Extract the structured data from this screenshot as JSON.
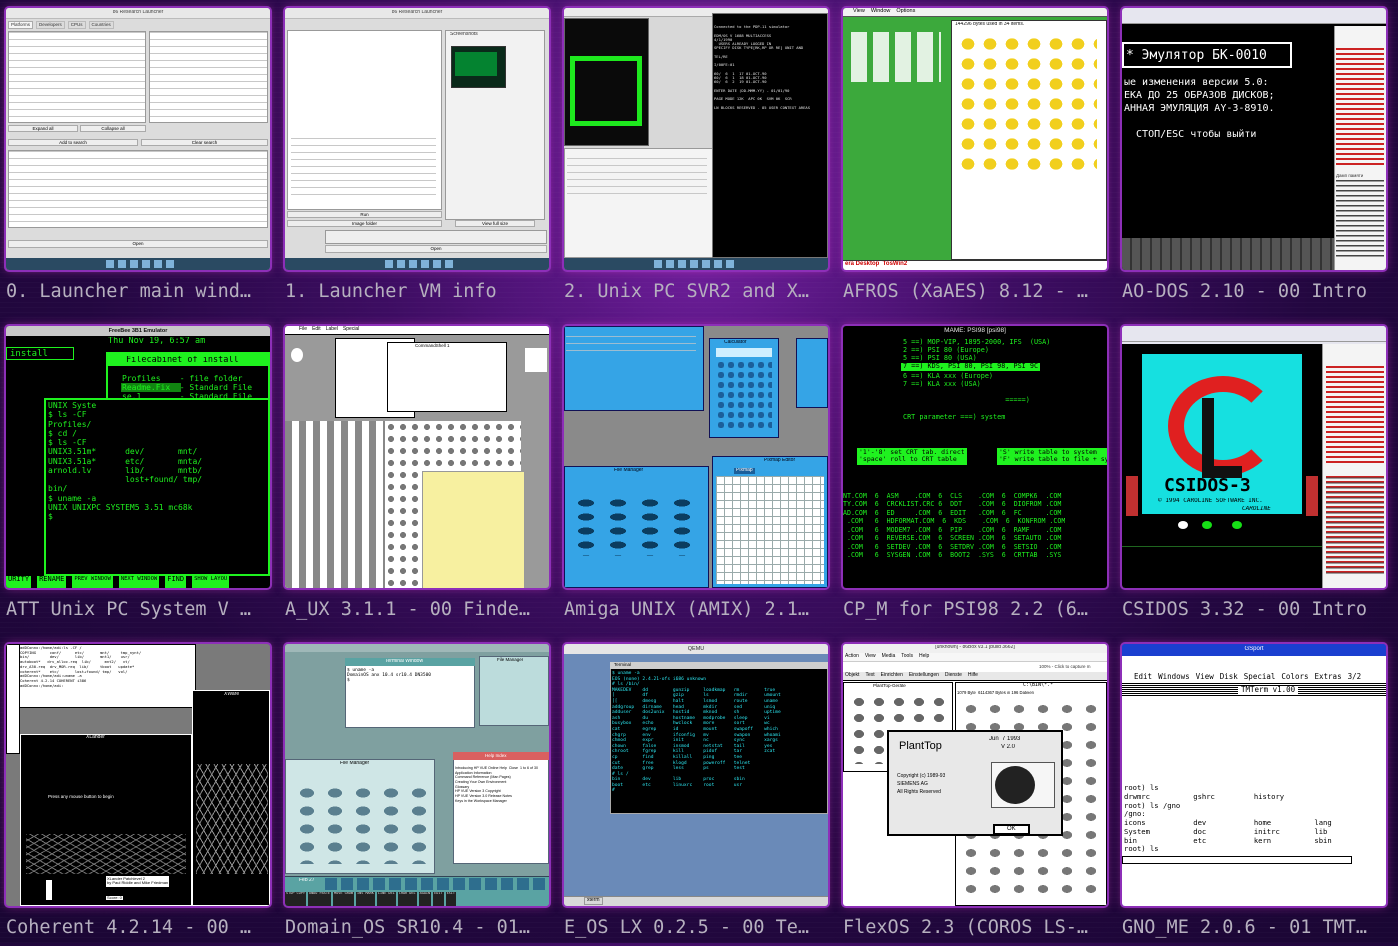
{
  "cards": [
    {
      "caption": "0. Launcher main wind…",
      "title": "86 Research Launcher",
      "tabs": [
        "Platforms",
        "Developers",
        "CPUs",
        "Countries"
      ],
      "buttons": [
        "Expand all",
        "Collapse all",
        "Add to search",
        "Clear search",
        "Open"
      ]
    },
    {
      "caption": "1. Launcher VM info",
      "title": "86 Research Launcher",
      "panel": "Screenshots",
      "buttons": [
        "Run",
        "Image folder",
        "View full size",
        "Open"
      ]
    },
    {
      "caption": "2. Unix PC SVR2 and X…",
      "title": "Unix Terminal",
      "lines": [
        "Connected to the PDP-11 simulator",
        "",
        "EDM/OS V 1688 MULTIACCESS",
        "4/1/1990",
        "  USERS ALREADY LOGGED IN",
        "SPECIFY DISK TYPE[RK,RP OR RE] UNIT AND",
        "",
        "TEL/RE",
        "",
        "I/00FE:01",
        "",
        "60/  6  1  17 01-OCT-90",
        "60/  6  1  18 01-OCT-90",
        "60/  6  2  19 01-OCT-90",
        "",
        "ENTER DATE (DD-MMM-YY) - 01/01/90",
        "",
        "PAGE MODE 12K  APC 0K  SVM 0K  SCR",
        "",
        "LN BLOCKS RESERVED - 85 USER CONTEXT AREAS"
      ]
    },
    {
      "caption": "AFROS (XaAES) 8.12 - …",
      "menu": [
        "View",
        "Window",
        "Options"
      ],
      "info": "144296 bytes used in 34 items.",
      "taskbar": "era Desktop  TosWin2"
    },
    {
      "caption": "AO-DOS 2.10 - 00 Intro",
      "banner": "* Эмулятор БК-0010",
      "lines": [
        "ые изменения версии 5.0:",
        "ЕКА ДО 25 ОБРАЗОВ ДИСКОВ;",
        "АННАЯ ЭМУЛЯЦИЯ AY-3-8910.",
        "",
        "  СТОП/ESC чтобы выйти"
      ],
      "side_label": "Дамп памяти"
    },
    {
      "caption": "ATT Unix PC System V …",
      "title": "FreeBee 3B1 Emulator",
      "date": "Thu Nov 19, 6:57 am",
      "window": "Filecabinet of install",
      "rows": [
        "Profiles    - file folder",
        "Readme.Fix  - Standard File",
        "se.1        - Standard File"
      ],
      "shell": [
        "UNIX Syste",
        "$ ls -CF",
        "Profiles/",
        "$ cd /",
        "$ ls -CF",
        "UNIX3.51m*      dev/       mnt/",
        "UNIX3.51a*      etc/       mnta/",
        "arnold.lv       lib/       mntb/",
        "                lost+found/ tmp/",
        "bin/",
        "$ uname -a",
        "UNIX UNIXPC SYSTEM5 3.51 mc68k",
        "$"
      ],
      "fkeys": [
        "URITY",
        "RENAME",
        "PREV WINDOW",
        "NEXT WINDOW",
        "FIND",
        "SHOW LAYOU"
      ]
    },
    {
      "caption": "A_UX 3.1.1 - 00 Finde…",
      "menu": [
        "File",
        "Edit",
        "Label",
        "Special"
      ],
      "window": "CommandShell 1"
    },
    {
      "caption": "Amiga UNIX (AMIX) 2.1…",
      "calc": "Calculator",
      "files": "File Manager",
      "pixmap": "Pixmap Editor",
      "button": "Pixmap"
    },
    {
      "caption": "CP_M for PSI98 2.2 (6…",
      "title": "MAME: PSI98 [psi98]",
      "lines": [
        "5 ==) MOP-VIP, 1895-2000, IFS  (USA)",
        "2 ==) PSI 80 (Europe)",
        "5 ==) PSI 80 (USA)"
      ],
      "hl": "7 ==) KDS, PSI 80, PSI 98, PSI 9C",
      "lines2": [
        "6 ==) KLA xxx (Europe)",
        "7 ==) KLA xxx (USA)",
        "",
        "                         =====)",
        "",
        "CRT parameter ===) system"
      ],
      "box1": "'1'-'8' set CRT tab. direct\n'space' roll to CRT table",
      "box2": "'S' write table to system\n'F' write table to file + syst",
      "dir": [
        "NT.COM  6  ASM    .COM  6  CLS    .COM  6  COMPK6  .COM",
        "TY.COM  6  CRCKLIST.CRC 6  DDT    .COM  6  DIOFROM .COM",
        "AD.COM  6  ED     .COM  6  EDIT   .COM  6  FC      .COM",
        " .COM   6  HDFORMAT.COM  6  KDS    .COM  6  KONFROM .COM",
        " .COM   6  MODEM7 .COM  6  PIP    .COM  6  RAMF    .COM",
        " .COM   6  REVERSE.COM  6  SCREEN .COM  6  SETAUTO .COM",
        " .COM   6  SETDEV .COM  6  SETDRV .COM  6  SETSIO  .COM",
        " .COM   6  SYSGEN .COM  6  BOOT2  .SYS  6  CRTTAB  .SYS"
      ]
    },
    {
      "caption": "CSIDOS 3.32 - 00 Intro",
      "logo": "CSIDOS-3",
      "copy": "© 1994 CAROLINE SOFTWARE INC.",
      "sig": "CAROLINE"
    },
    {
      "caption": "Coherent 4.2.14 - 00 …",
      "terminal": [
        "adDConnx:/home/adi:ls -CF /",
        "COPYING      conf/      etc/       mnt/     tmp_nynt/",
        "bin/         dev/       lib/       mnt1/    usr/",
        "autoboot*   drv_alloc.req  lib/      mnt2/   vt/",
        "drv_A30.req  drv_MOR.req  lib/     tboot   update*",
        "coherent*    etc/       lost+found/ tmp/   vol/",
        "adDConnx:/home/adi:uname -a",
        "Coherent 4.2.14 COHERENT i386",
        "adDConnx:/home/adi:"
      ],
      "xlander": "XLander",
      "prompt": "Press any mouse button to begin",
      "credit": "XLander Patchlevel 2\nby Paul Riddle and Mike Friedman",
      "score": "Score: 0",
      "xware": "XWare"
    },
    {
      "caption": "Domain_OS SR10.4 - 01…",
      "term": "Terminal Window",
      "term_lines": [
        "$ uname -a",
        "DomainOS anx 10.4 sr10.4 DN3500",
        "$"
      ],
      "fm": "File Manager",
      "help": "Help Index",
      "help_lines": [
        "Introducing HP VUE Online Help  Close  1 to 6 of 30",
        "Application Information",
        "Command Reference (Man Pages)",
        "Creating Your Own Environment",
        "Glossary",
        "HP VUE Version 3 Copyright",
        "HP VUE Version 3.0 Release Notes",
        "Keys in the Workspace Manager"
      ],
      "date": "Feb 27",
      "keys": [
        "STOP COPY",
        "UNDO PASTE",
        "MOVE GROW",
        "INS MARK",
        "LINE DEL",
        "CHAR DEL",
        "AGAIN",
        "EDIT",
        "EXIT"
      ]
    },
    {
      "caption": "E_OS LX 0.2.5 - 00 Te…",
      "title": "QEMU",
      "terminal": "Terminal",
      "lines": [
        "$ uname -a",
        "EOS (none) 2.4.21-ofs i686 unknown",
        "# ls /bin/",
        "MAKEDEV    dd         gunzip     loadkmap   rm         true",
        "[          df         gzip       ls         rmdir      umount",
        "[[         dmesg      halt       lsmod      route      uname",
        "addgroup   dirname    head       mkdir      sed        uniq",
        "adduser    dos2unix   hostid     mknod      sh         uptime",
        "ash        du         hostname   modprobe   sleep      vi",
        "busybox    echo       hwclock    more       sort       wc",
        "cat        egrep      id         mount      swapoff    which",
        "chgrp      env        ifconfig   mv         swapon     whoami",
        "chmod      expr       init       nc         sync       xargs",
        "chown      false      insmod     netstat    tail       yes",
        "chroot     fgrep      kill       pidof      tar        zcat",
        "cp         find       killall    ping       tee",
        "cut        free       klogd      poweroff   telnet",
        "date       grep       less       ps         test",
        "# ls /",
        "bin        dev        lib        proc       sbin",
        "boot       etc        linuxrc    root       usr",
        "#"
      ],
      "task": "xterm"
    },
    {
      "caption": "FlexOS 2.3 (COROS LS-…",
      "title": "[unknown] - 86Box v3.1 [build 3662]",
      "menu": [
        "Action",
        "View",
        "Media",
        "Tools",
        "Help"
      ],
      "status": "100% - Click to capture m",
      "app_menu": [
        "Objekt",
        "Text",
        "Einrichten",
        "Einstellungen",
        "Dienste",
        "Hilfe"
      ],
      "panel": "PlantTop-Geräte",
      "path": "C:\\BIN\\*.*",
      "files": "1079 Byte  6114367 Bytes in 196 Dateien",
      "splash_title": "PlantTop",
      "splash_date": "Jun  7 1993",
      "version": "V 2.0",
      "copyright": [
        "Copyright (c) 1989-93",
        "SIEMENS AG",
        "All Rights Reserved"
      ],
      "ok": "OK"
    },
    {
      "caption": "GNO_ME 2.0.6 - 01 TMT…",
      "title": "GSport",
      "menu": [
        "Edit",
        "Windows",
        "View",
        "Disk",
        "Special",
        "Colors",
        "Extras",
        "3/2"
      ],
      "app": "TMTerm v1.00",
      "lines": [
        "root) ls",
        "drwmrc          gshrc         history",
        "root) ls /gno",
        "/gno:",
        "icons           dev           home          lang",
        "System          doc           initrc        lib",
        "bin             etc           kern          sbin",
        "root) ls"
      ]
    }
  ]
}
